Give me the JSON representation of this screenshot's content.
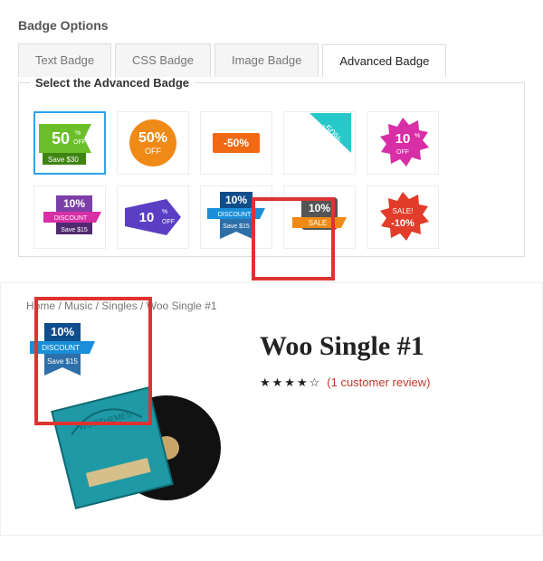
{
  "panel": {
    "title": "Badge Options"
  },
  "tabs": [
    {
      "label": "Text Badge",
      "active": false
    },
    {
      "label": "CSS Badge",
      "active": false
    },
    {
      "label": "Image Badge",
      "active": false
    },
    {
      "label": "Advanced Badge",
      "active": true
    }
  ],
  "fieldset": {
    "legend": "Select the Advanced Badge"
  },
  "badges": [
    {
      "name": "green-corner-50",
      "selected": true,
      "big": "50",
      "small": "%\nOFF",
      "sub": "Save $30"
    },
    {
      "name": "orange-circle-50",
      "big": "50%",
      "small": "OFF"
    },
    {
      "name": "orange-pill-minus50",
      "big": "-50%"
    },
    {
      "name": "teal-ribbon-50",
      "big": "-50%"
    },
    {
      "name": "magenta-burst-10",
      "big": "10",
      "small": "%\nOFF"
    },
    {
      "name": "purple-stack-10",
      "big": "10%",
      "small": "DISCOUNT",
      "sub": "Save $15"
    },
    {
      "name": "violet-arrow-10",
      "big": "10",
      "small": "%\nOFF"
    },
    {
      "name": "blue-ribbon-10",
      "big": "10%",
      "small": "DISCOUNT",
      "sub": "Save $15"
    },
    {
      "name": "grey-ribbon-10",
      "big": "10%",
      "small": "SALE"
    },
    {
      "name": "red-burst-10",
      "big": "SALE!",
      "small": "-10%"
    }
  ],
  "preview": {
    "breadcrumbs": "Home / Music / Singles / Woo Single #1",
    "title": "Woo Single #1",
    "stars": "★★★★☆",
    "review": "(1 customer review)",
    "applied_badge": {
      "big": "10%",
      "small": "DISCOUNT",
      "sub": "Save $15"
    }
  }
}
